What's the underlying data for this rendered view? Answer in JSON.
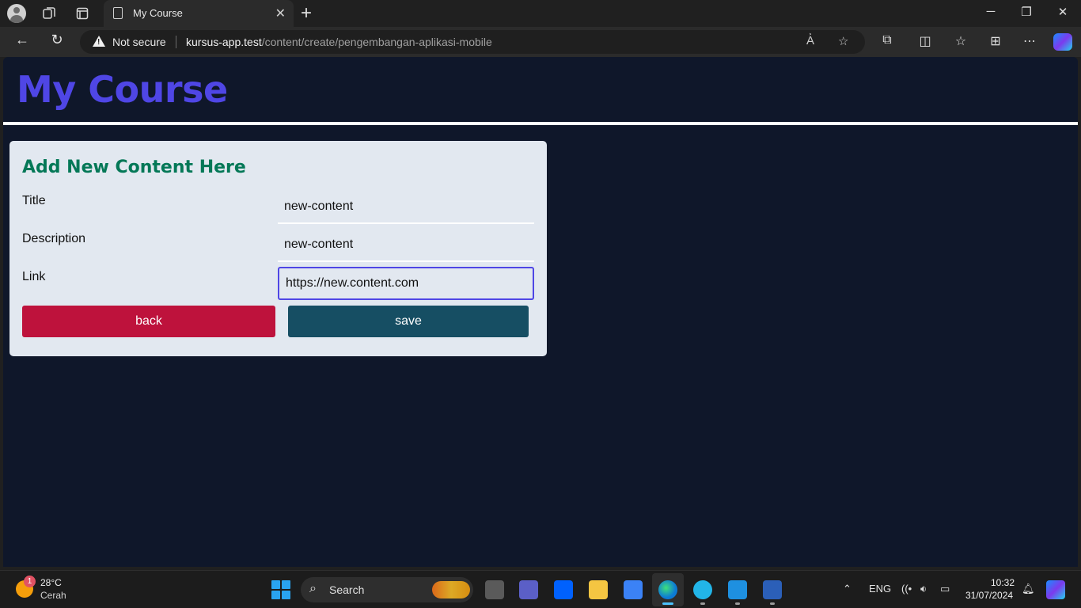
{
  "browser": {
    "tab_title": "My Course",
    "tab_close": "✕",
    "new_tab": "+",
    "window_minimize": "─",
    "window_restore": "❐",
    "window_close": "✕",
    "security_label": "Not secure",
    "url_host": "kursus-app.test",
    "url_path": "/content/create/pengembangan-aplikasi-mobile"
  },
  "page": {
    "site_title": "My Course",
    "form": {
      "heading": "Add New Content Here",
      "title_label": "Title",
      "title_value": "new-content",
      "description_label": "Description",
      "description_value": "new-content",
      "link_label": "Link",
      "link_value": "https://new.content.com",
      "back_label": "back",
      "save_label": "save"
    }
  },
  "colors": {
    "page_bg": "#0f172a",
    "site_title": "#4f46e5",
    "card_bg": "#e2e8f0",
    "heading": "#047857",
    "back_button": "#be123c",
    "save_button": "#164e63"
  },
  "taskbar": {
    "weather_temp": "28°C",
    "weather_condition": "Cerah",
    "weather_badge": "1",
    "search_label": "Search",
    "language": "ENG",
    "time": "10:32",
    "date": "31/07/2024",
    "apps": [
      "task-view-icon",
      "teams-icon",
      "dropbox-icon",
      "file-explorer-icon",
      "store-icon",
      "edge-icon",
      "app-icon",
      "vscode-icon",
      "word-icon"
    ]
  }
}
